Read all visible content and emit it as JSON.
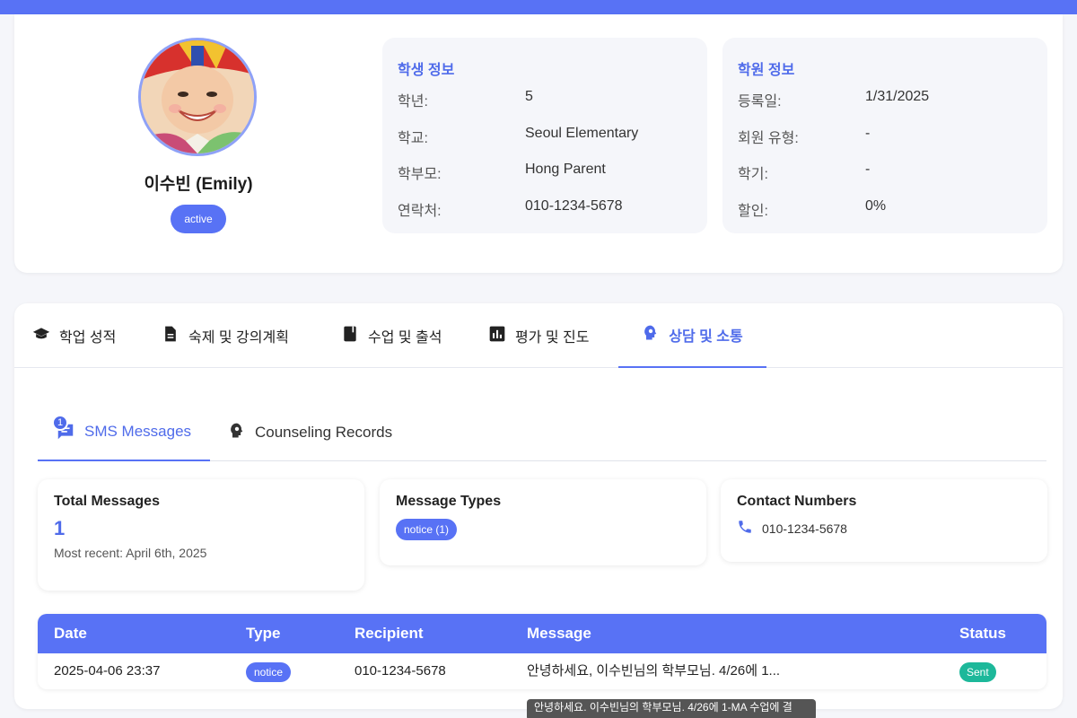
{
  "profile": {
    "name": "이수빈 (Emily)",
    "status": "active",
    "student_info": {
      "title": "학생 정보",
      "rows": [
        {
          "key": "학년:",
          "value": "5"
        },
        {
          "key": "학교:",
          "value": "Seoul Elementary"
        },
        {
          "key": "학부모:",
          "value": "Hong Parent"
        },
        {
          "key": "연락처:",
          "value": "010-1234-5678"
        }
      ]
    },
    "academy_info": {
      "title": "학원 정보",
      "rows": [
        {
          "key": "등록일:",
          "value": "1/31/2025"
        },
        {
          "key": "회원 유형:",
          "value": "-"
        },
        {
          "key": "학기:",
          "value": "-"
        },
        {
          "key": "할인:",
          "value": "0%"
        }
      ]
    }
  },
  "tabs": [
    {
      "label": "학업 성적",
      "icon": "graduation-cap-icon"
    },
    {
      "label": "숙제 및 강의계획",
      "icon": "document-icon"
    },
    {
      "label": "수업 및 출석",
      "icon": "book-icon"
    },
    {
      "label": "평가 및 진도",
      "icon": "bar-chart-icon"
    },
    {
      "label": "상담 및 소통",
      "icon": "lightbulb-head-icon",
      "active": true
    }
  ],
  "subtabs": [
    {
      "label": "SMS Messages",
      "badge": "1",
      "icon": "message-icon",
      "active": true
    },
    {
      "label": "Counseling Records",
      "icon": "lightbulb-head-icon"
    }
  ],
  "stats": {
    "total": {
      "title": "Total Messages",
      "value": "1",
      "sub": "Most recent: April 6th, 2025"
    },
    "types": {
      "title": "Message Types",
      "pill": "notice (1)"
    },
    "contacts": {
      "title": "Contact Numbers",
      "number": "010-1234-5678"
    }
  },
  "table": {
    "headers": {
      "date": "Date",
      "type": "Type",
      "recipient": "Recipient",
      "message": "Message",
      "status": "Status"
    },
    "rows": [
      {
        "date": "2025-04-06 23:37",
        "type": "notice",
        "recipient": "010-1234-5678",
        "message": "안녕하세요, 이수빈님의 학부모님. 4/26에 1...",
        "status": "Sent"
      }
    ]
  },
  "tooltip": "안녕하세요. 이수빈님의 학부모님. 4/26에 1-MA 수업에 결",
  "colors": {
    "accent": "#5872f5",
    "success": "#1db89a"
  }
}
